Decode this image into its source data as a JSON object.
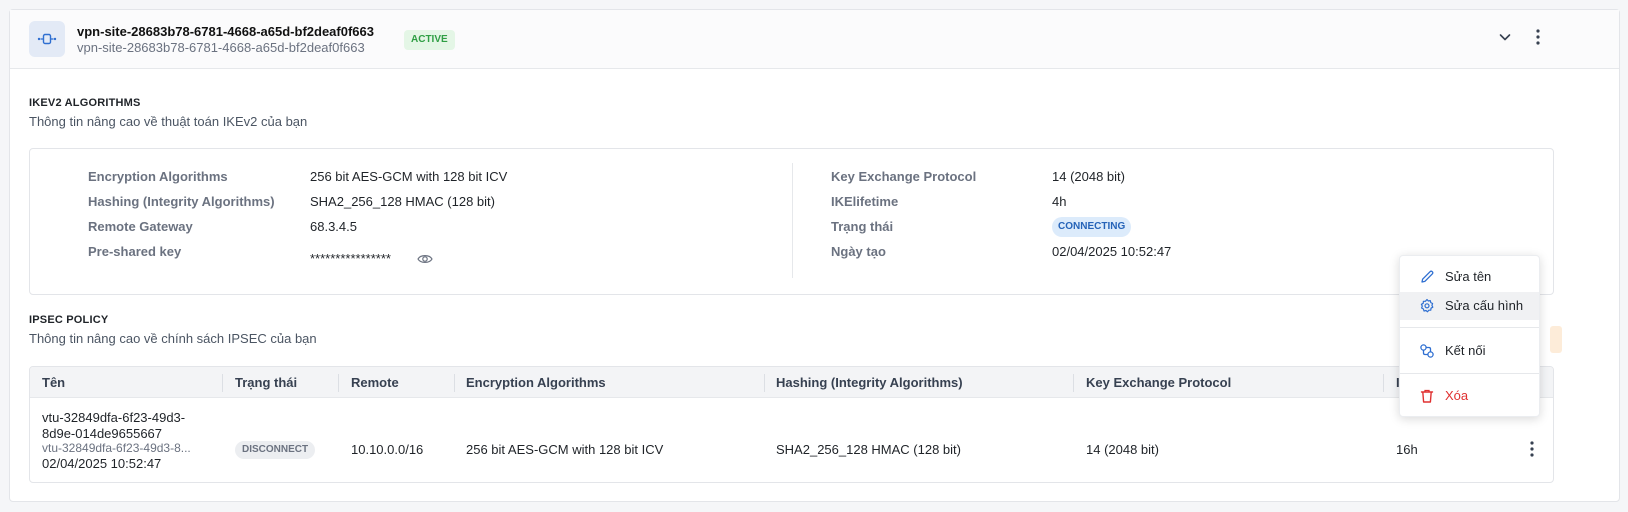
{
  "site": {
    "title": "vpn-site-28683b78-6781-4668-a65d-bf2deaf0f663",
    "subtitle": "vpn-site-28683b78-6781-4668-a65d-bf2deaf0f663",
    "status": "ACTIVE",
    "icon": "site-to-site-vpn-icon"
  },
  "ikev2": {
    "title": "IKEV2 ALGORITHMS",
    "description": "Thông tin nâng cao về thuật toán IKEv2 của bạn",
    "left": [
      {
        "label": "Encryption Algorithms",
        "value": "256 bit AES-GCM with 128 bit ICV"
      },
      {
        "label": "Hashing (Integrity Algorithms)",
        "value": "SHA2_256_128 HMAC (128 bit)"
      },
      {
        "label": "Remote Gateway",
        "value": "68.3.4.5"
      },
      {
        "label": "Pre-shared key",
        "value": "****************"
      }
    ],
    "right": [
      {
        "label": "Key Exchange Protocol",
        "value": "14 (2048 bit)"
      },
      {
        "label": "IKElifetime",
        "value": "4h"
      },
      {
        "label": "Trạng thái",
        "value": "CONNECTING"
      },
      {
        "label": "Ngày tạo",
        "value": "02/04/2025 10:52:47"
      }
    ]
  },
  "ipsec": {
    "title": "IPSEC POLICY",
    "description": "Thông tin nâng cao về chính sách IPSEC của bạn",
    "columns": [
      "Tên",
      "Trạng thái",
      "Remote",
      "Encryption Algorithms",
      "Hashing (Integrity Algorithms)",
      "Key Exchange Protocol",
      "II"
    ],
    "rows": [
      {
        "name_line1": "vtu-32849dfa-6f23-49d3-",
        "name_line2": "8d9e-014de9655667",
        "name_sub": "vtu-32849dfa-6f23-49d3-8...",
        "created": "02/04/2025 10:52:47",
        "status": "DISCONNECT",
        "remote": "10.10.0.0/16",
        "encryption": "256 bit AES-GCM with 128 bit ICV",
        "hashing": "SHA2_256_128 HMAC (128 bit)",
        "key_exchange": "14 (2048 bit)",
        "lifetime": "16h"
      }
    ]
  },
  "menu": {
    "items": [
      {
        "label": "Sửa tên",
        "icon": "pencil-icon"
      },
      {
        "label": "Sửa cấu hình",
        "icon": "settings-gear-icon"
      },
      {
        "label": "Kết nối",
        "icon": "connect-icon"
      },
      {
        "label": "Xóa",
        "icon": "trash-icon"
      }
    ]
  },
  "colors": {
    "active_green": "#2f9e44",
    "connecting_blue": "#2563b8",
    "danger_red": "#e03131",
    "icon_blue": "#2f6fd1"
  }
}
